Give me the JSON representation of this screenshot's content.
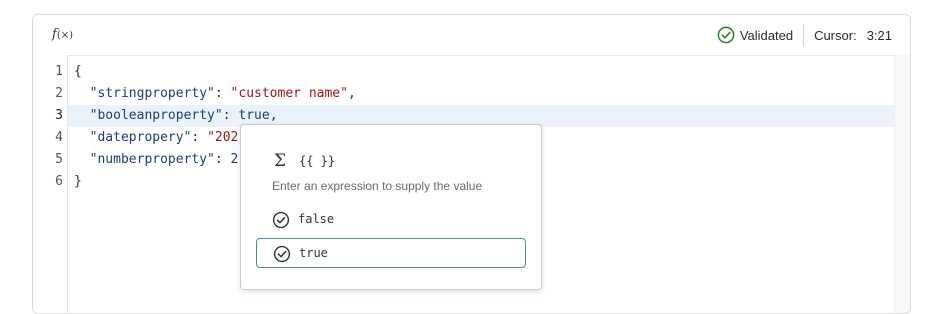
{
  "toolbar": {
    "fx_main": "f",
    "fx_sub": "(×)",
    "status_label": "Validated",
    "cursor_label": "Cursor:",
    "cursor_position": "3:21"
  },
  "gutter": {
    "line_numbers": [
      "1",
      "2",
      "3",
      "4",
      "5",
      "6"
    ]
  },
  "code": {
    "l1": "{",
    "l2_key": "\"stringproperty\"",
    "l2_colon": ": ",
    "l2_val": "\"customer name\"",
    "l2_end": ",",
    "l3_key": "\"booleanproperty\"",
    "l3_colon": ": ",
    "l3_val": "true",
    "l3_end": ",",
    "l4_key": "\"datepropery\"",
    "l4_colon": ": ",
    "l4_val": "\"202",
    "l5_key": "\"numberproperty\"",
    "l5_colon": ": ",
    "l5_val": "2",
    "l6": "}"
  },
  "suggest": {
    "sigma": "Σ",
    "expression_label": "{{ }}",
    "hint": "Enter an expression to supply the value",
    "options": [
      "false",
      "true"
    ],
    "selected_option": "true"
  },
  "colors": {
    "validated": "#2e7d32",
    "active_line": "#eaf3fb",
    "selected_border": "#5a7fb0",
    "string": "#a31515",
    "key": "#1f3f73"
  },
  "icons": {
    "fx": "function-icon",
    "validated": "check-circle-icon",
    "option_check": "check-circle-icon"
  }
}
